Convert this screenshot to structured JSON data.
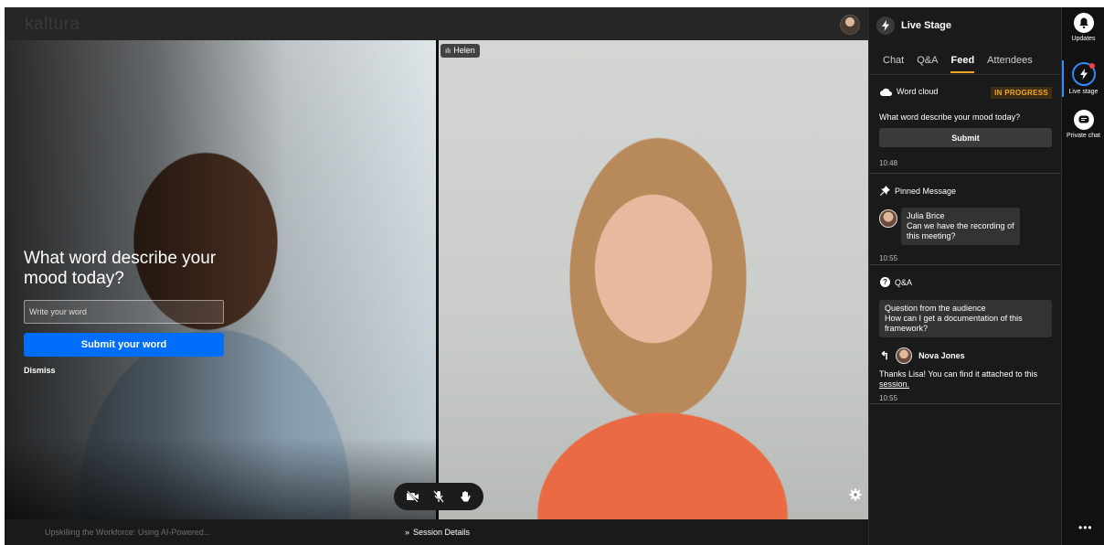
{
  "app": {
    "logo_text": "kaltura",
    "accent_color": "#006efa",
    "feed_tab_color": "#f5a623"
  },
  "stage": {
    "participant_name": "Helen",
    "poll": {
      "question": "What word describe your mood today?",
      "input_placeholder": "Write your word",
      "submit_label": "Submit your word",
      "dismiss_label": "Dismiss"
    }
  },
  "bottom_bar": {
    "session_title": "Upskilling the Workforce: Using AI-Powered...",
    "session_details_label": "Session Details"
  },
  "panel": {
    "title": "Live Stage",
    "tabs": [
      {
        "label": "Chat",
        "active": false
      },
      {
        "label": "Q&A",
        "active": false
      },
      {
        "label": "Feed",
        "active": true
      },
      {
        "label": "Attendees",
        "active": false
      }
    ],
    "word_cloud": {
      "title": "Word cloud",
      "status": "IN PROGRESS",
      "question": "What word describe your mood today?",
      "submit_label": "Submit",
      "time": "10:48"
    },
    "pinned": {
      "title": "Pinned Message",
      "author": "Julia Brice",
      "message": "Can we have the recording of this meeting?",
      "time": "10:55"
    },
    "qa": {
      "title": "Q&A",
      "question_header": "Question from the audience",
      "question": "How can I get a documentation of this framework?",
      "answer_author": "Nova Jones",
      "answer_text": "Thanks Lisa! You can find it attached to this",
      "answer_link": "session.",
      "time": "10:55"
    }
  },
  "rail": {
    "updates_label": "Updates",
    "live_stage_label": "Live stage",
    "private_chat_label": "Private chat",
    "more_label": "•••"
  }
}
